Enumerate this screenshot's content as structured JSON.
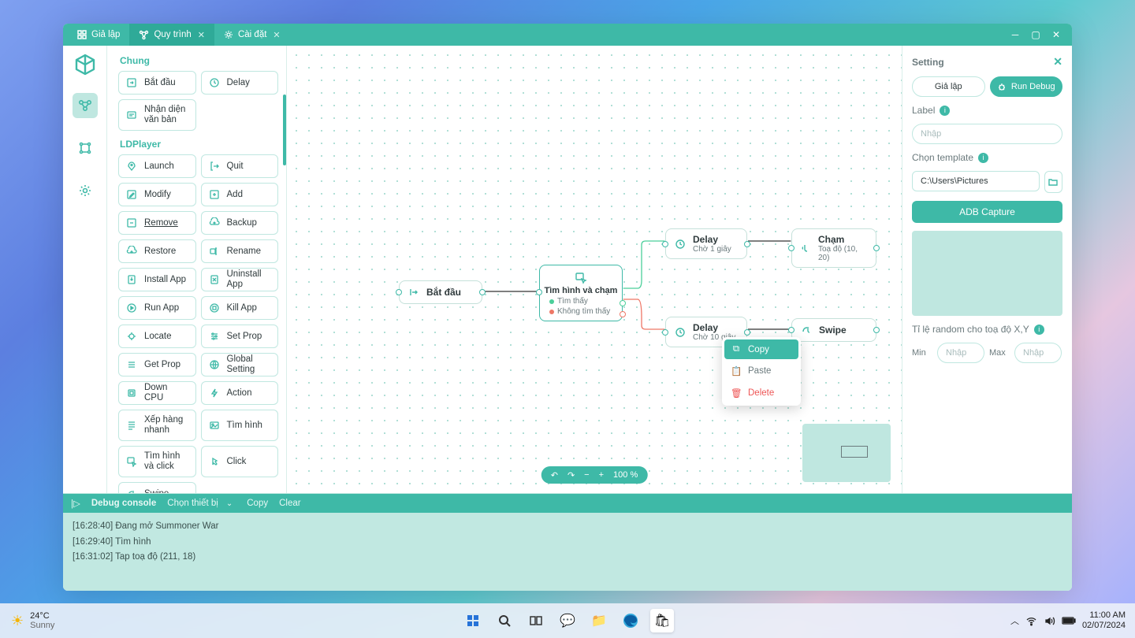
{
  "tabs": [
    {
      "label": "Giả lập"
    },
    {
      "label": "Quy trình"
    },
    {
      "label": "Cài đặt"
    }
  ],
  "palette": {
    "cat1": "Chung",
    "chung": [
      {
        "label": "Bắt đầu"
      },
      {
        "label": "Delay"
      },
      {
        "label": "Nhận diện văn bản"
      }
    ],
    "cat2": "LDPlayer",
    "ld": [
      {
        "label": "Launch"
      },
      {
        "label": "Quit"
      },
      {
        "label": "Modify"
      },
      {
        "label": "Add"
      },
      {
        "label": "Remove"
      },
      {
        "label": "Backup"
      },
      {
        "label": "Restore"
      },
      {
        "label": "Rename"
      },
      {
        "label": "Install App"
      },
      {
        "label": "Uninstall App"
      },
      {
        "label": "Run App"
      },
      {
        "label": "Kill App"
      },
      {
        "label": "Locate"
      },
      {
        "label": "Set Prop"
      },
      {
        "label": "Get Prop"
      },
      {
        "label": "Global Setting"
      },
      {
        "label": "Down CPU"
      },
      {
        "label": "Action"
      },
      {
        "label": "Xếp hàng nhanh"
      },
      {
        "label": "Tìm hình"
      },
      {
        "label": "Tìm hình và click"
      },
      {
        "label": "Click"
      },
      {
        "label": "Swipe"
      }
    ]
  },
  "canvas": {
    "start": "Bắt đầu",
    "findtap": {
      "title": "Tìm hình và chạm",
      "found": "Tìm thấy",
      "notfound": "Không tìm thấy"
    },
    "delay1": {
      "title": "Delay",
      "sub": "Chờ 1 giây"
    },
    "delay10": {
      "title": "Delay",
      "sub": "Chờ  10 giây"
    },
    "tap": {
      "title": "Chạm",
      "sub": "Toạ độ (10, 20)"
    },
    "swipe": {
      "title": "Swipe"
    }
  },
  "zoom": {
    "pct": "100 %"
  },
  "ctx": {
    "copy": "Copy",
    "paste": "Paste",
    "delete": "Delete"
  },
  "inspector": {
    "title": "Setting",
    "runmode": "Giả lập",
    "run": "Run Debug",
    "label": "Label",
    "label_ph": "Nhập",
    "tmpl": "Chọn template",
    "tmpl_val": "C:\\Users\\Pictures",
    "adb": "ADB Capture",
    "rand": "Tỉ lệ random cho toạ độ X,Y",
    "min": "Min",
    "max": "Max",
    "num_ph": "Nhập"
  },
  "console": {
    "title": "Debug console",
    "device": "Chọn thiết bị",
    "copy": "Copy",
    "clear": "Clear",
    "lines": [
      "[16:28:40] Đang mở Summoner War",
      "[16:29:40] Tìm hình",
      "[16:31:02] Tap toạ độ (211, 18)"
    ]
  },
  "taskbar": {
    "temp": "24°C",
    "cond": "Sunny",
    "time": "11:00 AM",
    "date": "02/07/2024"
  }
}
